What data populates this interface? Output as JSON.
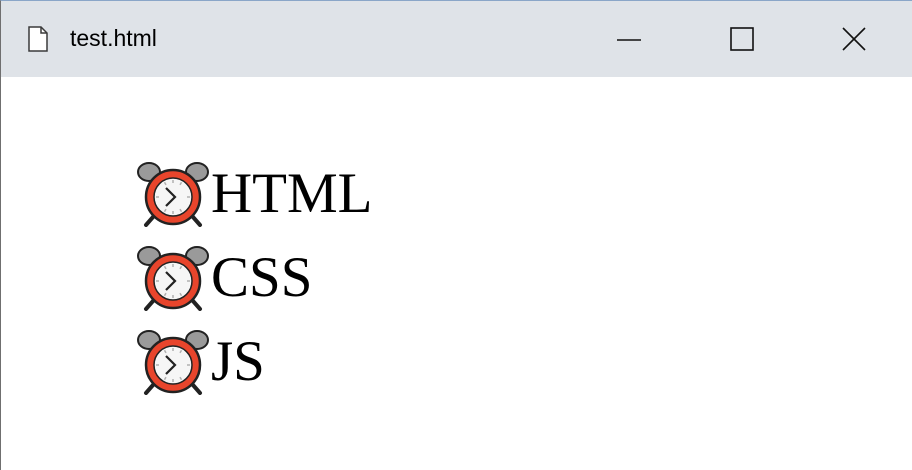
{
  "window": {
    "title": "test.html",
    "controls": {
      "minimize_icon": "minimize-icon",
      "maximize_icon": "maximize-icon",
      "close_icon": "close-icon"
    },
    "titlebar_color": "#dfe3e8"
  },
  "list": {
    "icon": "alarm-clock-icon",
    "items": [
      {
        "label": "HTML"
      },
      {
        "label": "CSS"
      },
      {
        "label": "JS"
      }
    ]
  },
  "colors": {
    "clock_face": "#e8452c",
    "clock_bells": "#9a9a9a"
  }
}
